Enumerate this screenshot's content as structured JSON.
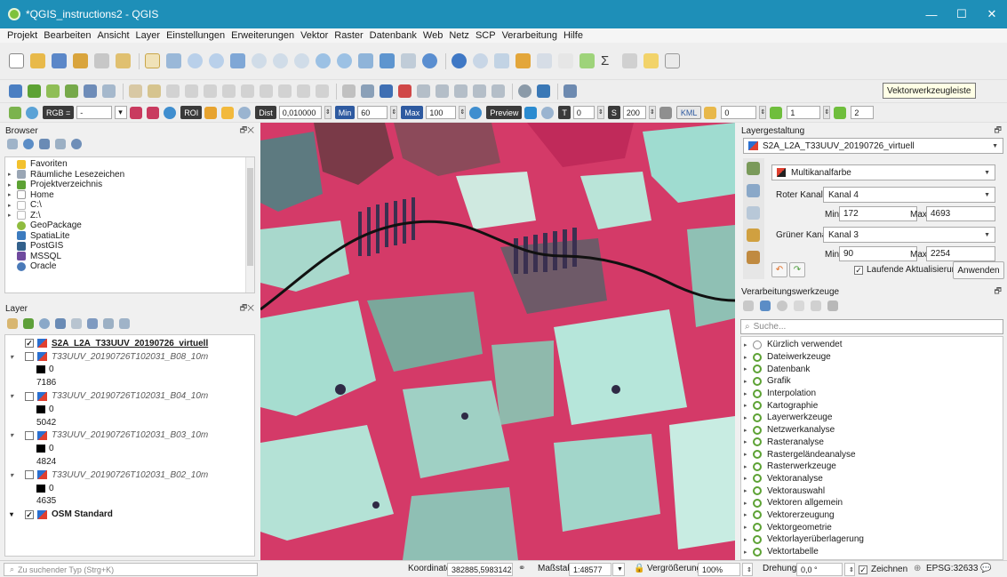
{
  "window": {
    "title": "*QGIS_instructions2 - QGIS",
    "minimize": "—",
    "maximize": "☐",
    "close": "✕"
  },
  "menu": [
    "Projekt",
    "Bearbeiten",
    "Ansicht",
    "Layer",
    "Einstellungen",
    "Erweiterungen",
    "Vektor",
    "Raster",
    "Datenbank",
    "Web",
    "Netz",
    "SCP",
    "Verarbeitung",
    "Hilfe"
  ],
  "tooltip": "Vektorwerkzeugleiste",
  "scp_toolbar": {
    "rgb_label": "RGB =",
    "rgb_value": "-",
    "roi_label": "ROI",
    "dist_label": "Dist",
    "dist_value": "0,010000",
    "min_label": "Min",
    "min_value": "60",
    "max_label": "Max",
    "max_value": "100",
    "preview_label": "Preview",
    "t_label": "T",
    "t_value": "0",
    "s_label": "S",
    "s_value": "200",
    "kml_label": "KML",
    "field_a": "0",
    "field_b": "1",
    "field_c": "2"
  },
  "browser": {
    "title": "Browser",
    "items": [
      {
        "label": "Favoriten",
        "icon": "star-icon",
        "arrow": "",
        "color": "#f2c12e"
      },
      {
        "label": "Räumliche Lesezeichen",
        "icon": "bookmark-icon",
        "arrow": "▸",
        "color": "#9aa6b5"
      },
      {
        "label": "Projektverzeichnis",
        "icon": "project-folder-icon",
        "arrow": "▸",
        "color": "#5da234"
      },
      {
        "label": "Home",
        "icon": "home-icon",
        "arrow": "▸",
        "color": "#9a9a9a"
      },
      {
        "label": "C:\\",
        "icon": "drive-icon",
        "arrow": "▸",
        "color": "#b8b8b8"
      },
      {
        "label": "Z:\\",
        "icon": "drive-icon",
        "arrow": "▸",
        "color": "#b8b8b8"
      },
      {
        "label": "GeoPackage",
        "icon": "geopackage-icon",
        "arrow": "",
        "color": "#8fbc3f"
      },
      {
        "label": "SpatiaLite",
        "icon": "spatialite-icon",
        "arrow": "",
        "color": "#3c7bbf"
      },
      {
        "label": "PostGIS",
        "icon": "postgis-icon",
        "arrow": "",
        "color": "#33618c"
      },
      {
        "label": "MSSQL",
        "icon": "mssql-icon",
        "arrow": "",
        "color": "#6f4a9e"
      },
      {
        "label": "Oracle",
        "icon": "oracle-icon",
        "arrow": "",
        "color": "#4a7ab8"
      }
    ]
  },
  "layers": {
    "title": "Layer",
    "items": [
      {
        "name": "S2A_L2A_T33UUV_20190726_virtuell",
        "checked": true,
        "bold": true,
        "expand": "",
        "min": "",
        "max": ""
      },
      {
        "name": "T33UUV_20190726T102031_B08_10m",
        "checked": false,
        "bold": false,
        "expand": "▾",
        "min": "0",
        "max": "7186"
      },
      {
        "name": "T33UUV_20190726T102031_B04_10m",
        "checked": false,
        "bold": false,
        "expand": "▾",
        "min": "0",
        "max": "5042"
      },
      {
        "name": "T33UUV_20190726T102031_B03_10m",
        "checked": false,
        "bold": false,
        "expand": "▾",
        "min": "0",
        "max": "4824"
      },
      {
        "name": "T33UUV_20190726T102031_B02_10m",
        "checked": false,
        "bold": false,
        "expand": "▾",
        "min": "0",
        "max": "4635"
      },
      {
        "name": "OSM Standard",
        "checked": true,
        "bold": true,
        "expand": "▾",
        "min": "",
        "max": ""
      }
    ]
  },
  "styling": {
    "title": "Layergestaltung",
    "layer": "S2A_L2A_T33UUV_20190726_virtuell",
    "renderer": "Multikanalfarbe",
    "red_label": "Roter Kanal",
    "red_band": "Kanal 4",
    "red_min_label": "Min",
    "red_min": "172",
    "red_max_label": "Max",
    "red_max": "4693",
    "green_label": "Grüner Kanal",
    "green_band": "Kanal 3",
    "green_min_label": "Min",
    "green_min": "90",
    "green_max_label": "Max",
    "green_max": "2254",
    "live_update": "Laufende Aktualisierung",
    "apply": "Anwenden"
  },
  "processing": {
    "title": "Verarbeitungswerkzeuge",
    "search_placeholder": "Suche...",
    "items": [
      "Kürzlich verwendet",
      "Dateiwerkzeuge",
      "Datenbank",
      "Grafik",
      "Interpolation",
      "Kartographie",
      "Layerwerkzeuge",
      "Netzwerkanalyse",
      "Rasteranalyse",
      "Rastergeländeanalyse",
      "Rasterwerkzeuge",
      "Vektoranalyse",
      "Vektorauswahl",
      "Vektoren allgemein",
      "Vektorerzeugung",
      "Vektorgeometrie",
      "Vektorlayerüberlagerung",
      "Vektortabelle"
    ]
  },
  "status": {
    "search_placeholder": "Zu suchender Typ (Strg+K)",
    "coord_label": "Koordinate",
    "coord": "382885,5983142",
    "scale_label": "Maßstab",
    "scale": "1:48577",
    "zoom_label": "Vergrößerung",
    "zoom": "100%",
    "rotation_label": "Drehung",
    "rotation": "0,0 °",
    "render_label": "Zeichnen",
    "crs": "EPSG:32633"
  },
  "colors": {
    "titlebar": "#1e8fb8",
    "map_red": "#d43a68",
    "map_pale": "#9fdcd0",
    "qgis_green": "#5da234"
  }
}
